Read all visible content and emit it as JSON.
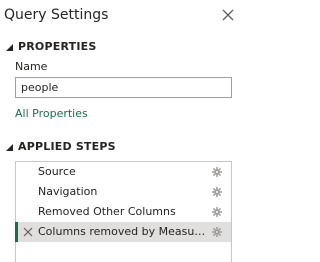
{
  "panel": {
    "title": "Query Settings",
    "close_icon": "close-icon"
  },
  "properties": {
    "section_label": "PROPERTIES",
    "name_label": "Name",
    "name_value": "people",
    "all_properties_link": "All Properties"
  },
  "applied_steps": {
    "section_label": "APPLIED STEPS",
    "steps": [
      {
        "label": "Source",
        "icon": "gear-icon",
        "selected": false
      },
      {
        "label": "Navigation",
        "icon": "gear-icon",
        "selected": false
      },
      {
        "label": "Removed Other Columns",
        "icon": "gear-icon",
        "selected": false
      },
      {
        "label": "Columns removed by Measur...",
        "icon": "gear-icon",
        "selected": true
      }
    ]
  },
  "colors": {
    "link": "#1a6e4b",
    "selected_bg": "#e1dfdd",
    "selected_bar": "#1a6e4b"
  }
}
